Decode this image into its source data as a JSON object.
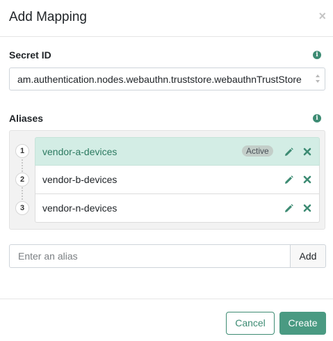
{
  "modal": {
    "title": "Add Mapping",
    "close_symbol": "×"
  },
  "secret_id": {
    "label": "Secret ID",
    "info_icon": "info-circle-icon",
    "value": "am.authentication.nodes.webauthn.truststore.webauthnTrustStore"
  },
  "aliases": {
    "label": "Aliases",
    "info_icon": "info-circle-icon",
    "active_badge": "Active",
    "items": [
      {
        "step": "1",
        "name": "vendor-a-devices",
        "active": true
      },
      {
        "step": "2",
        "name": "vendor-b-devices",
        "active": false
      },
      {
        "step": "3",
        "name": "vendor-n-devices",
        "active": false
      }
    ],
    "row_icons": [
      "pencil-icon",
      "close-icon"
    ]
  },
  "alias_input": {
    "value": "",
    "placeholder": "Enter an alias",
    "add_label": "Add"
  },
  "footer": {
    "cancel_label": "Cancel",
    "create_label": "Create"
  },
  "colors": {
    "accent": "#3d8b73",
    "create_button": "#4a9a82",
    "active_row": "#d3ede5"
  }
}
